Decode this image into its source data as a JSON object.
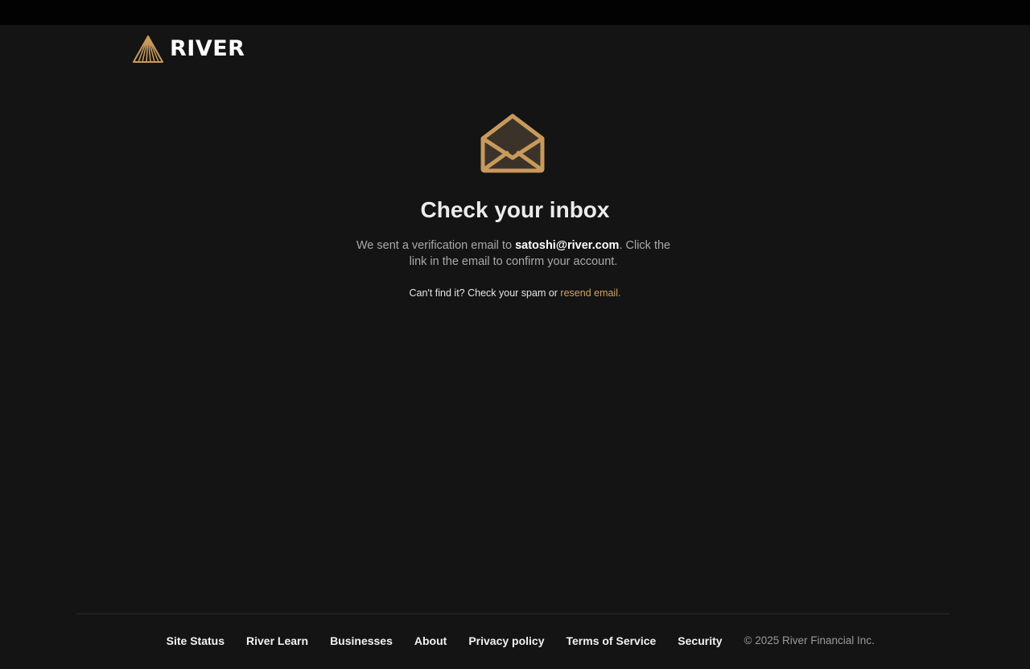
{
  "header": {
    "brand": "RIVER"
  },
  "main": {
    "title": "Check your inbox",
    "description_before": "We sent a verification email to ",
    "email": "satoshi@river.com",
    "description_after": ". Click the link in the email to confirm your account.",
    "hint_text": "Can't find it? Check your spam or ",
    "resend_label": "resend email."
  },
  "footer": {
    "links": [
      "Site Status",
      "River Learn",
      "Businesses",
      "About",
      "Privacy policy",
      "Terms of Service",
      "Security"
    ],
    "copyright": "© 2025 River Financial Inc."
  },
  "colors": {
    "background": "#141414",
    "topbar": "#020202",
    "accent_gold": "#c89a5b",
    "link_gold": "#d2a164"
  },
  "icons": {
    "logo": "river-logo-icon",
    "envelope": "open-envelope-icon"
  }
}
